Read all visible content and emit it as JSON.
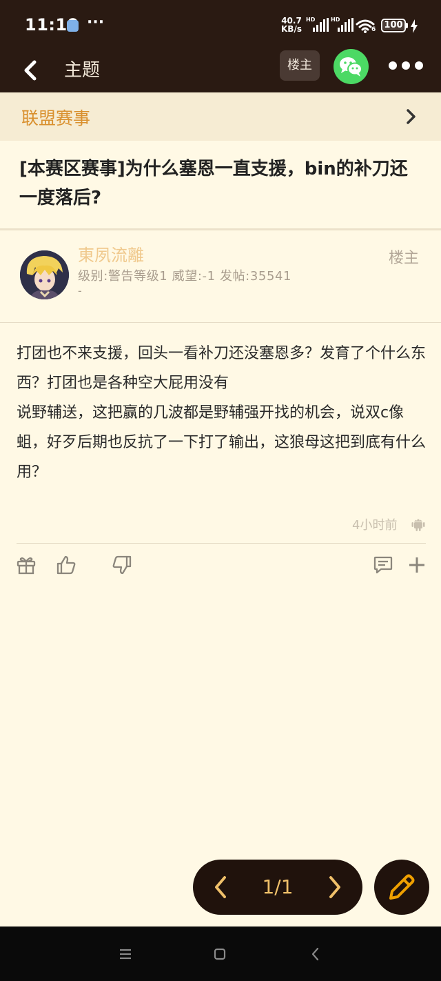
{
  "status_bar": {
    "time": "11:19",
    "dots": "···",
    "net_speed_value": "40.7",
    "net_speed_unit": "KB/s",
    "signal_label": "HD",
    "wifi_label": "6",
    "battery": "100"
  },
  "header": {
    "title": "主题",
    "owner_filter_label": "楼主"
  },
  "forum": {
    "name": "联盟赛事"
  },
  "thread": {
    "title": "[本赛区赛事]为什么塞恩一直支援，bin的补刀还一度落后?"
  },
  "post": {
    "author": "東夙流離",
    "author_meta": "级别:警告等级1 威望:-1 发帖:35541",
    "author_extra": "-",
    "owner_tag": "楼主",
    "content": "打团也不来支援，回头一看补刀还没塞恩多？发育了个什么东西？打团也是各种空大屁用没有\n说野辅送，这把赢的几波都是野辅强开找的机会，说双c像蛆，好歹后期也反抗了一下打了输出，这狼母这把到底有什么用？",
    "time": "4小时前"
  },
  "pager": {
    "text": "1/1"
  },
  "colors": {
    "header_bg": "#2a1a12",
    "page_bg": "#fff9e5",
    "forum_accent": "#d9902e",
    "author_name": "#f0c98d",
    "pager_text": "#f0c06a",
    "wechat_green": "#4cd964"
  },
  "icons": {
    "back": "chevron-left-icon",
    "wechat": "wechat-icon",
    "more": "more-dots-icon",
    "forum_arrow": "chevron-right-icon",
    "platform": "android-icon",
    "gift": "gift-icon",
    "like": "thumbs-up-icon",
    "dislike": "thumbs-down-icon",
    "comment": "comment-icon",
    "add": "plus-icon",
    "compose": "pencil-icon"
  }
}
